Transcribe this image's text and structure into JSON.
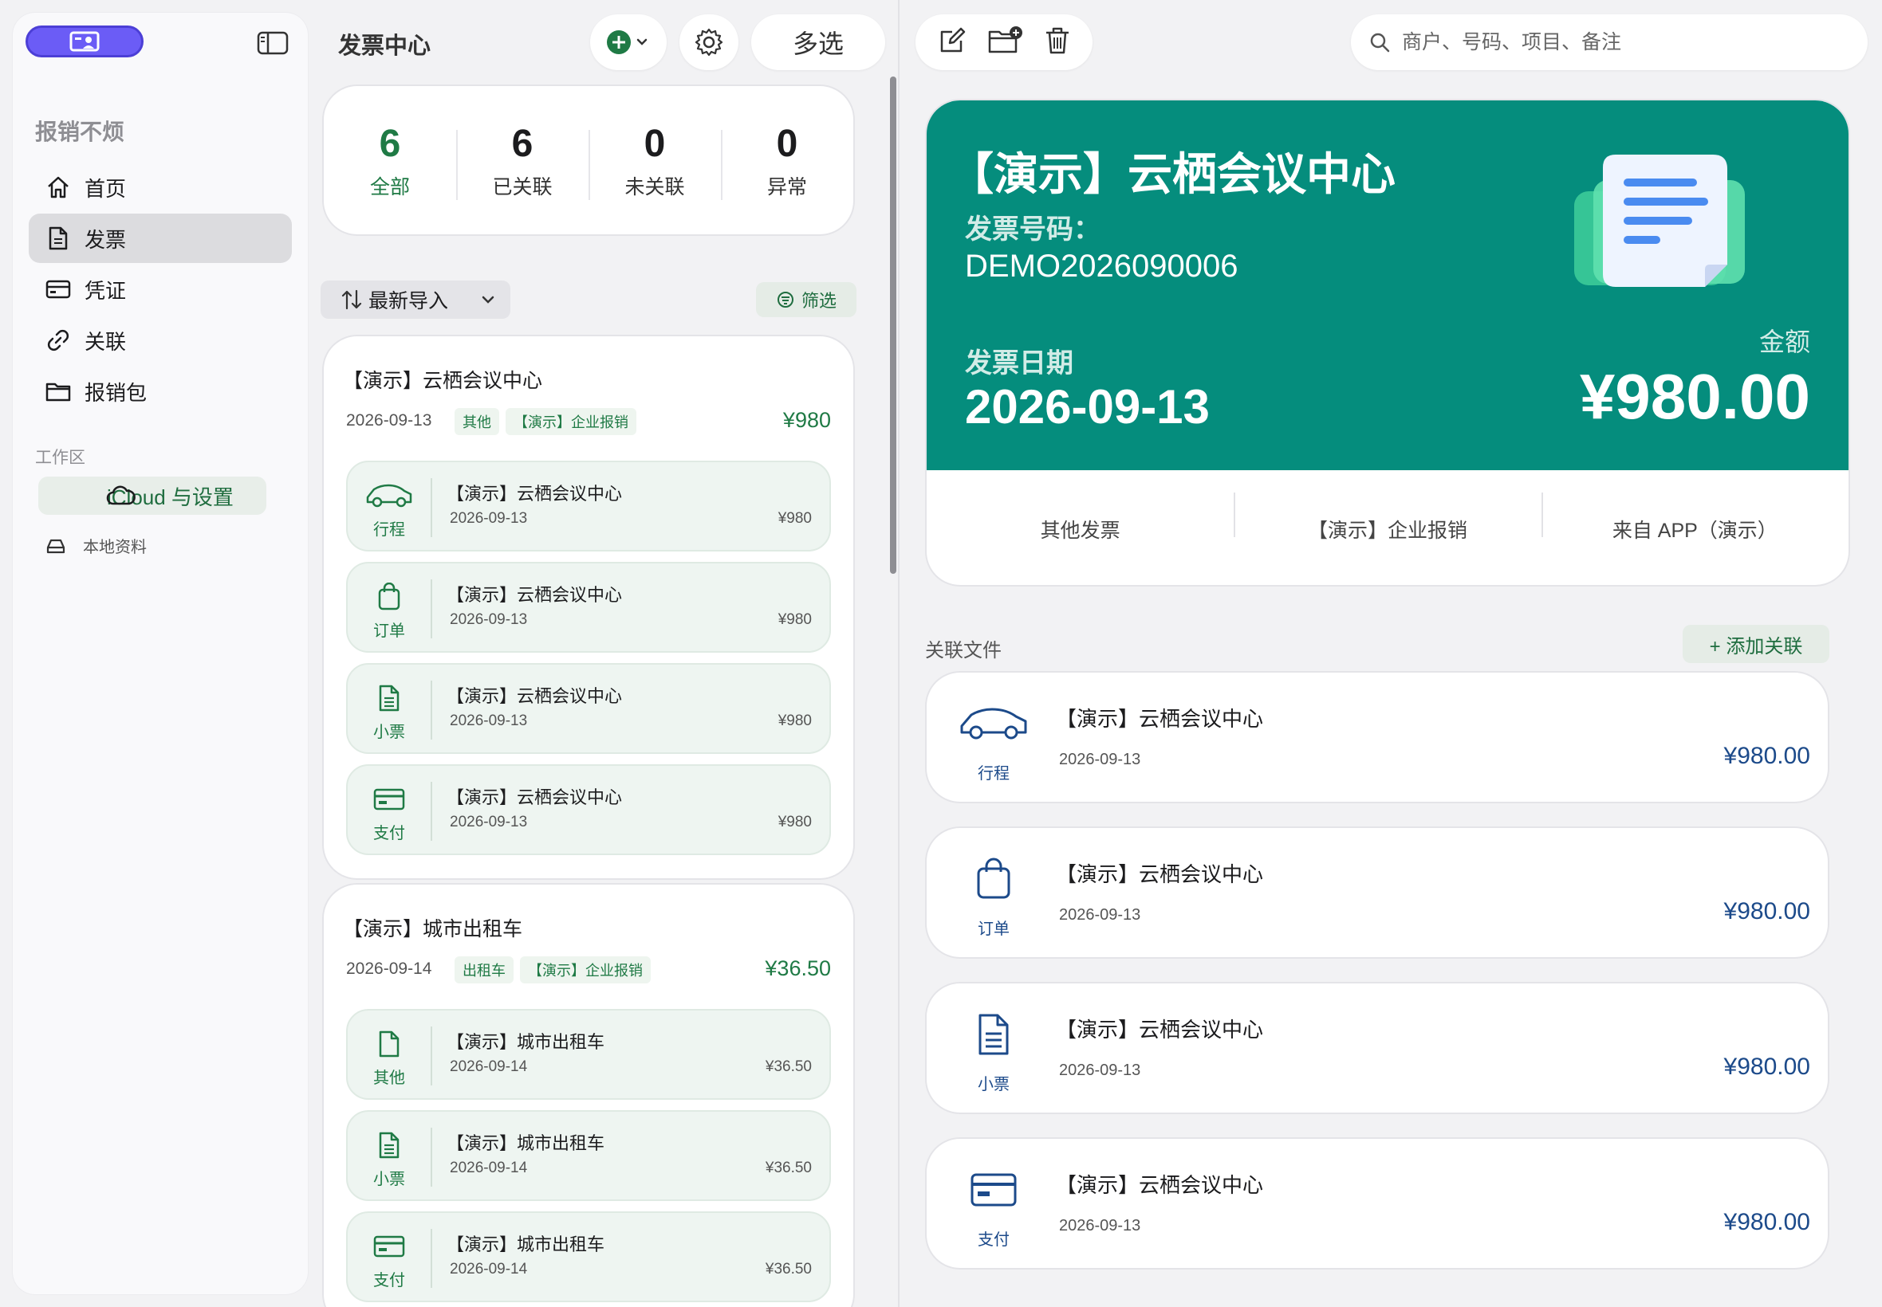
{
  "sidebar": {
    "app_title": "报销不烦",
    "items": [
      {
        "label": "首页",
        "icon": "home-icon"
      },
      {
        "label": "发票",
        "icon": "document-icon",
        "active": true
      },
      {
        "label": "凭证",
        "icon": "card-icon"
      },
      {
        "label": "关联",
        "icon": "link-icon"
      },
      {
        "label": "报销包",
        "icon": "folder-icon"
      }
    ],
    "section_label": "工作区",
    "icloud_label": "iCloud 与设置",
    "local_label": "本地资料"
  },
  "middle": {
    "title": "发票中心",
    "multi_select_label": "多选",
    "stats": [
      {
        "value": "6",
        "label": "全部"
      },
      {
        "value": "6",
        "label": "已关联"
      },
      {
        "value": "0",
        "label": "未关联"
      },
      {
        "value": "0",
        "label": "异常"
      }
    ],
    "sort_label": "最新导入",
    "filter_label": "筛选",
    "groups": [
      {
        "title": "【演示】云栖会议中心",
        "date": "2026-09-13",
        "tags": [
          "其他",
          "【演示】企业报销"
        ],
        "amount": "¥980",
        "subs": [
          {
            "label": "行程",
            "icon": "car-icon",
            "title": "【演示】云栖会议中心",
            "date": "2026-09-13",
            "amount": "¥980"
          },
          {
            "label": "订单",
            "icon": "bag-icon",
            "title": "【演示】云栖会议中心",
            "date": "2026-09-13",
            "amount": "¥980"
          },
          {
            "label": "小票",
            "icon": "receipt-icon",
            "title": "【演示】云栖会议中心",
            "date": "2026-09-13",
            "amount": "¥980"
          },
          {
            "label": "支付",
            "icon": "card-icon",
            "title": "【演示】云栖会议中心",
            "date": "2026-09-13",
            "amount": "¥980"
          }
        ]
      },
      {
        "title": "【演示】城市出租车",
        "date": "2026-09-14",
        "tags": [
          "出租车",
          "【演示】企业报销"
        ],
        "amount": "¥36.50",
        "subs": [
          {
            "label": "其他",
            "icon": "document-icon",
            "title": "【演示】城市出租车",
            "date": "2026-09-14",
            "amount": "¥36.50"
          },
          {
            "label": "小票",
            "icon": "receipt-icon",
            "title": "【演示】城市出租车",
            "date": "2026-09-14",
            "amount": "¥36.50"
          },
          {
            "label": "支付",
            "icon": "card-icon",
            "title": "【演示】城市出租车",
            "date": "2026-09-14",
            "amount": "¥36.50"
          }
        ]
      }
    ]
  },
  "detail": {
    "search_placeholder": "商户、号码、项目、备注",
    "name": "【演示】云栖会议中心",
    "invoice_no_label": "发票号码：",
    "invoice_no": "DEMO2026090006",
    "date_label": "发票日期",
    "date": "2026-09-13",
    "amount_label": "金额",
    "amount": "¥980.00",
    "meta": [
      "其他发票",
      "【演示】企业报销",
      "来自 APP（演示）"
    ],
    "related_title": "关联文件",
    "add_related_label": "+ 添加关联",
    "related": [
      {
        "label": "行程",
        "icon": "car-icon",
        "title": "【演示】云栖会议中心",
        "date": "2026-09-13",
        "amount": "¥980.00"
      },
      {
        "label": "订单",
        "icon": "bag-icon",
        "title": "【演示】云栖会议中心",
        "date": "2026-09-13",
        "amount": "¥980.00"
      },
      {
        "label": "小票",
        "icon": "receipt-icon",
        "title": "【演示】云栖会议中心",
        "date": "2026-09-13",
        "amount": "¥980.00"
      },
      {
        "label": "支付",
        "icon": "card-icon",
        "title": "【演示】云栖会议中心",
        "date": "2026-09-13",
        "amount": "¥980.00"
      }
    ]
  },
  "colors": {
    "accent_green": "#1f7a45",
    "hero_teal": "#058d7d",
    "related_blue": "#1c4a8a",
    "user_button_purple": "#6b5cf6"
  }
}
